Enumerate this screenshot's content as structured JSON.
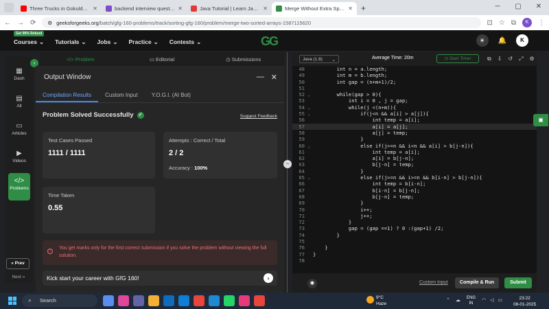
{
  "browser": {
    "tabs": [
      {
        "title": "Three Trucks in Gokuldham! | F",
        "color": "#ff0000"
      },
      {
        "title": "backend interview questions e",
        "color": "#7b4fc9"
      },
      {
        "title": "Java Tutorial | Learn Java Progr",
        "color": "#e53935"
      },
      {
        "title": "Merge Without Extra Space | Pr",
        "color": "#2f8d46"
      }
    ],
    "url_host": "geeksforgeeks.org",
    "url_path": "/batch/gfg-160-problems/track/sorting-gfg-160/problem/merge-two-sorted-arrays-1587115620",
    "profile_initial": "K"
  },
  "gfg_nav": {
    "badge": "Get 90% Refund",
    "items": [
      "Courses",
      "Tutorials",
      "Jobs",
      "Practice",
      "Contests"
    ],
    "logo": "GG",
    "user_initial": "K"
  },
  "sidebar": {
    "items": [
      {
        "label": "Dash",
        "icon": "dashboard-icon"
      },
      {
        "label": "All",
        "icon": "grid-icon"
      },
      {
        "label": "Articles",
        "icon": "article-icon"
      },
      {
        "label": "Videos",
        "icon": "video-icon"
      },
      {
        "label": "Problems",
        "icon": "code-icon"
      }
    ],
    "prev": "« Prev",
    "next": "Next »"
  },
  "problem_tabs": [
    "Problem",
    "Editorial",
    "Submissions"
  ],
  "output": {
    "title": "Output Window",
    "tabs": [
      "Compilation Results",
      "Custom Input",
      "Y.O.G.I. (AI Bot)"
    ],
    "status": "Problem Solved Successfully",
    "suggest": "Suggest Feedback",
    "test_cases_label": "Test Cases Passed",
    "test_cases_value": "1111 / 1111",
    "attempts_label": "Attempts : Correct / Total",
    "attempts_value": "2 / 2",
    "accuracy_label": "Accuracy :",
    "accuracy_value": "100%",
    "time_label": "Time Taken",
    "time_value": "0.55",
    "warning": "You get marks only for the first correct submission if you solve the problem without viewing the full solution.",
    "kickstart": "Kick start your career with GfG 160!"
  },
  "editor": {
    "language": "Java (1.8)",
    "avg_time": "Average Time: 20m",
    "timer": "Start Timer",
    "custom_input": "Custom Input",
    "compile_run": "Compile & Run",
    "submit": "Submit",
    "lines": [
      {
        "n": "48",
        "t": "        int n = a.length;"
      },
      {
        "n": "49",
        "t": "        int m = b.length;"
      },
      {
        "n": "50",
        "t": "        int gap = (n+m+1)/2;"
      },
      {
        "n": "51",
        "t": ""
      },
      {
        "n": "52",
        "t": "        while(gap > 0){"
      },
      {
        "n": "53",
        "t": "            int i = 0 , j = gap;"
      },
      {
        "n": "54",
        "t": "            while(j <(n+m)){"
      },
      {
        "n": "55",
        "t": "                if(j<n && a[i] > a[j]){"
      },
      {
        "n": "56",
        "t": "                    int temp = a[i];"
      },
      {
        "n": "57",
        "t": "                    a[i] = a[j];"
      },
      {
        "n": "58",
        "t": "                    a[j] = temp;"
      },
      {
        "n": "59",
        "t": "                }"
      },
      {
        "n": "60",
        "t": "                else if(j>=n && i<n && a[i] > b[j-n]){"
      },
      {
        "n": "61",
        "t": "                    int temp = a[i];"
      },
      {
        "n": "62",
        "t": "                    a[i] = b[j-n];"
      },
      {
        "n": "63",
        "t": "                    b[j-n] = temp;"
      },
      {
        "n": "64",
        "t": "                }"
      },
      {
        "n": "65",
        "t": "                else if(j>=n && i>=n && b[i-n] > b[j-n]){"
      },
      {
        "n": "66",
        "t": "                    int temp = b[i-n];"
      },
      {
        "n": "67",
        "t": "                    b[i-n] = b[j-n];"
      },
      {
        "n": "68",
        "t": "                    b[j-n] = temp;"
      },
      {
        "n": "69",
        "t": "                }"
      },
      {
        "n": "70",
        "t": "                i++;"
      },
      {
        "n": "71",
        "t": "                j++;"
      },
      {
        "n": "72",
        "t": "            }"
      },
      {
        "n": "73",
        "t": "            gap = (gap ==1) ? 0 :(gap+1) /2;"
      },
      {
        "n": "74",
        "t": "        }"
      },
      {
        "n": "75",
        "t": ""
      },
      {
        "n": "76",
        "t": "    }"
      },
      {
        "n": "77",
        "t": "}"
      },
      {
        "n": "78",
        "t": ""
      }
    ]
  },
  "taskbar": {
    "search": "Search",
    "weather_temp": "9°C",
    "weather_desc": "Haze",
    "lang1": "ENG",
    "lang2": "IN",
    "time": "23:22",
    "date": "08-01-2025"
  }
}
